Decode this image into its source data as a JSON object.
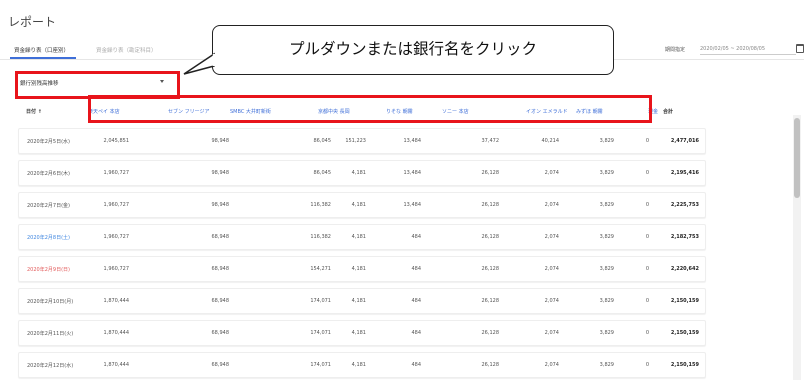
{
  "page": {
    "title": "レポート"
  },
  "tabs": [
    {
      "label": "資金繰り表（口座別）",
      "active": true
    },
    {
      "label": "資金繰り表（勘定科目）",
      "active": false
    }
  ],
  "period": {
    "label": "期間指定",
    "value": "2020/02/05 ~ 2020/08/05"
  },
  "select": {
    "value": "銀行別残高推移"
  },
  "callout": {
    "text": "プルダウンまたは銀行名をクリック"
  },
  "table": {
    "columns": [
      "日付 ↑",
      "楽天ペイ 本店",
      "セブン フリージア",
      "SMBC 大井町新街",
      "京都中央 長岡",
      "りそな 朝霧",
      "ソニー 本店",
      "イオン エメラルド",
      "みずほ 朝霧",
      "現金",
      "合計"
    ],
    "rows": [
      {
        "date": "2020年2月5日(水)",
        "values": [
          "2,045,851",
          "98,948",
          "86,045",
          "151,223",
          "13,484",
          "37,472",
          "40,214",
          "3,829",
          "0",
          "2,477,016"
        ]
      },
      {
        "date": "2020年2月6日(木)",
        "values": [
          "1,960,727",
          "98,948",
          "86,045",
          "4,181",
          "13,484",
          "26,128",
          "2,074",
          "3,829",
          "0",
          "2,195,416"
        ]
      },
      {
        "date": "2020年2月7日(金)",
        "values": [
          "1,960,727",
          "98,948",
          "116,382",
          "4,181",
          "13,484",
          "26,128",
          "2,074",
          "3,829",
          "0",
          "2,225,753"
        ]
      },
      {
        "date": "2020年2月8日(土)",
        "values": [
          "1,960,727",
          "68,948",
          "116,382",
          "4,181",
          "484",
          "26,128",
          "2,074",
          "3,829",
          "0",
          "2,182,753"
        ]
      },
      {
        "date": "2020年2月9日(日)",
        "values": [
          "1,960,727",
          "68,948",
          "154,271",
          "4,181",
          "484",
          "26,128",
          "2,074",
          "3,829",
          "0",
          "2,220,642"
        ]
      },
      {
        "date": "2020年2月10日(月)",
        "values": [
          "1,870,444",
          "68,948",
          "174,071",
          "4,181",
          "484",
          "26,128",
          "2,074",
          "3,829",
          "0",
          "2,150,159"
        ]
      },
      {
        "date": "2020年2月11日(火)",
        "values": [
          "1,870,444",
          "68,948",
          "174,071",
          "4,181",
          "484",
          "26,128",
          "2,074",
          "3,829",
          "0",
          "2,150,159"
        ]
      },
      {
        "date": "2020年2月12日(水)",
        "values": [
          "1,870,444",
          "68,948",
          "174,071",
          "4,181",
          "484",
          "26,128",
          "2,074",
          "3,829",
          "0",
          "2,150,159"
        ]
      }
    ]
  },
  "colors": {
    "accent": "#3f6fd8",
    "highlight": "#e8141b",
    "saturday": "#3f86e0",
    "sunday": "#e25a5a"
  }
}
